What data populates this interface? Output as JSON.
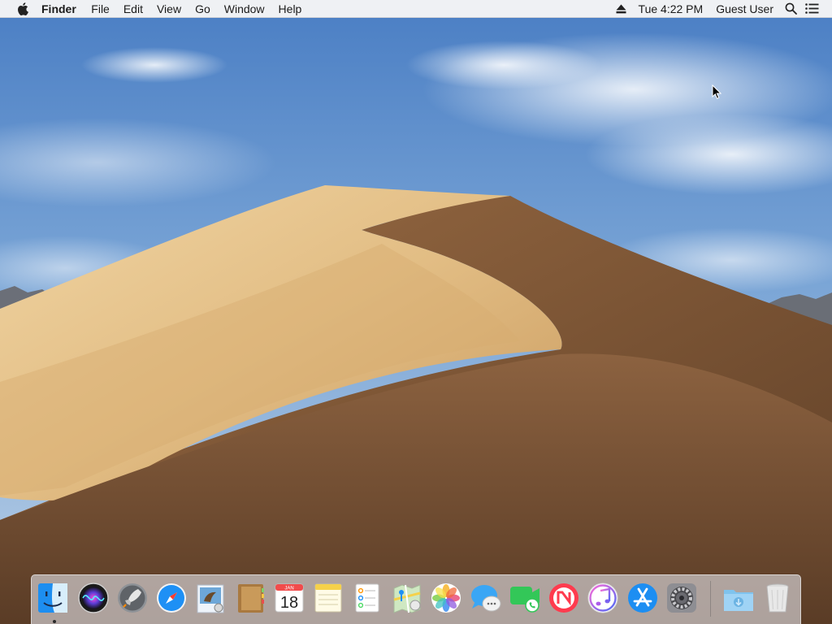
{
  "menubar": {
    "apple_icon": "apple-logo-icon",
    "app_name": "Finder",
    "menus": [
      "File",
      "Edit",
      "View",
      "Go",
      "Window",
      "Help"
    ],
    "status": {
      "eject_icon": "eject-icon",
      "clock": "Tue 4:22 PM",
      "user": "Guest User",
      "spotlight_icon": "spotlight-search-icon",
      "notification_icon": "notification-center-icon"
    }
  },
  "dock": {
    "apps": [
      {
        "name": "Finder",
        "icon": "finder-icon",
        "running": true
      },
      {
        "name": "Siri",
        "icon": "siri-icon"
      },
      {
        "name": "Launchpad",
        "icon": "launchpad-icon"
      },
      {
        "name": "Safari",
        "icon": "safari-icon"
      },
      {
        "name": "Mail",
        "icon": "mail-icon"
      },
      {
        "name": "Contacts",
        "icon": "contacts-icon"
      },
      {
        "name": "Calendar",
        "icon": "calendar-icon",
        "month": "JAN",
        "day": "18"
      },
      {
        "name": "Notes",
        "icon": "notes-icon"
      },
      {
        "name": "Reminders",
        "icon": "reminders-icon"
      },
      {
        "name": "Maps",
        "icon": "maps-icon"
      },
      {
        "name": "Photos",
        "icon": "photos-icon"
      },
      {
        "name": "Messages",
        "icon": "messages-icon"
      },
      {
        "name": "FaceTime",
        "icon": "facetime-icon"
      },
      {
        "name": "News",
        "icon": "news-icon"
      },
      {
        "name": "iTunes",
        "icon": "itunes-icon"
      },
      {
        "name": "App Store",
        "icon": "app-store-icon"
      },
      {
        "name": "System Preferences",
        "icon": "system-preferences-icon"
      }
    ],
    "others": [
      {
        "name": "Downloads",
        "icon": "downloads-folder-icon"
      },
      {
        "name": "Trash",
        "icon": "trash-icon"
      }
    ]
  },
  "colors": {
    "sky_top": "#4f82c6",
    "sky_bottom": "#a9c6e4",
    "dune_light": "#e6c48e",
    "dune_shadow": "#7a5434",
    "menubar_bg": "#f6f6f6"
  }
}
